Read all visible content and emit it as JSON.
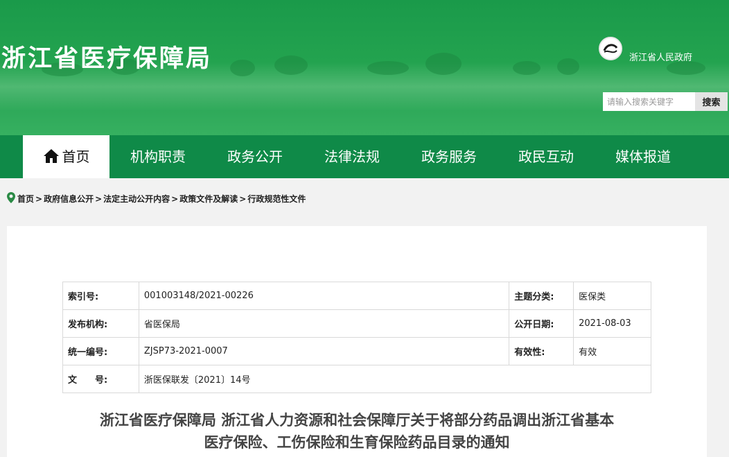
{
  "header": {
    "site_title": "浙江省医疗保障局",
    "gov_name": "浙江省人民政府",
    "search_placeholder": "请输入搜索关键字",
    "search_button": "搜索"
  },
  "nav": {
    "items": [
      {
        "label": "首页"
      },
      {
        "label": "机构职责"
      },
      {
        "label": "政务公开"
      },
      {
        "label": "法律法规"
      },
      {
        "label": "政务服务"
      },
      {
        "label": "政民互动"
      },
      {
        "label": "媒体报道"
      }
    ]
  },
  "breadcrumb": {
    "items": [
      "首页",
      "政府信息公开",
      "法定主动公开内容",
      "政策文件及解读",
      "行政规范性文件"
    ],
    "separator": ">"
  },
  "meta": {
    "row1": {
      "l1": "索引号:",
      "v1": "001003148/2021-00226",
      "l2": "主题分类:",
      "v2": "医保类"
    },
    "row2": {
      "l1": "发布机构:",
      "v1": "省医保局",
      "l2": "公开日期:",
      "v2": "2021-08-03"
    },
    "row3": {
      "l1": "统一编号:",
      "v1": "ZJSP73-2021-0007",
      "l2": "有效性:",
      "v2": "有效"
    },
    "row4": {
      "l1": "文　　号:",
      "v1": "浙医保联发〔2021〕14号"
    }
  },
  "document": {
    "title_line1": "浙江省医疗保障局 浙江省人力资源和社会保障厅关于将部分药品调出浙江省基本",
    "title_line2": "医疗保险、工伤保险和生育保险药品目录的通知"
  },
  "colors": {
    "banner_green": "#23a34f",
    "nav_green": "#0f8a48"
  }
}
